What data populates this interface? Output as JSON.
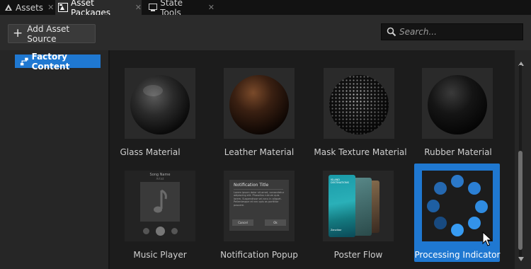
{
  "tabs": [
    {
      "label": "Assets",
      "icon": "assets-icon",
      "active": false
    },
    {
      "label": "Asset Packages",
      "icon": "asset-packages-icon",
      "active": true
    },
    {
      "label": "State Tools",
      "icon": "state-tools-icon",
      "active": false
    }
  ],
  "toolbar": {
    "add_label": "Add Asset Source",
    "search_placeholder": "Search..."
  },
  "tree": {
    "items": [
      {
        "label": "Factory Content",
        "icon": "network-icon",
        "selected": true
      }
    ]
  },
  "assets": [
    {
      "label": "Glass Material"
    },
    {
      "label": "Leather Material"
    },
    {
      "label": "Mask Texture Material"
    },
    {
      "label": "Rubber Material"
    },
    {
      "label": "Music Player"
    },
    {
      "label": "Notification Popup"
    },
    {
      "label": "Poster Flow"
    },
    {
      "label": "Processing Indicator",
      "selected": true
    }
  ],
  "thumbnail_text": {
    "music_song_name": "Song Name",
    "music_artist": "Artist",
    "notification_title": "Notification Title",
    "notification_body": "Lorem ipsum dolor sit amet, consectetur adipiscing elit. Phasellus rutrum quis lorem. Suspendisse vel arcu in aliquet. Pellentesque et nec quis as porttitor posuere.",
    "notification_cancel": "Cancel",
    "notification_ok": "Ok",
    "poster_title": "ISLAND DESTINATIONS",
    "poster_subtitle": "Zanzibar"
  },
  "colors": {
    "accent": "#1f78d1",
    "panel": "#2b2b2b",
    "tabbar": "#121212"
  }
}
